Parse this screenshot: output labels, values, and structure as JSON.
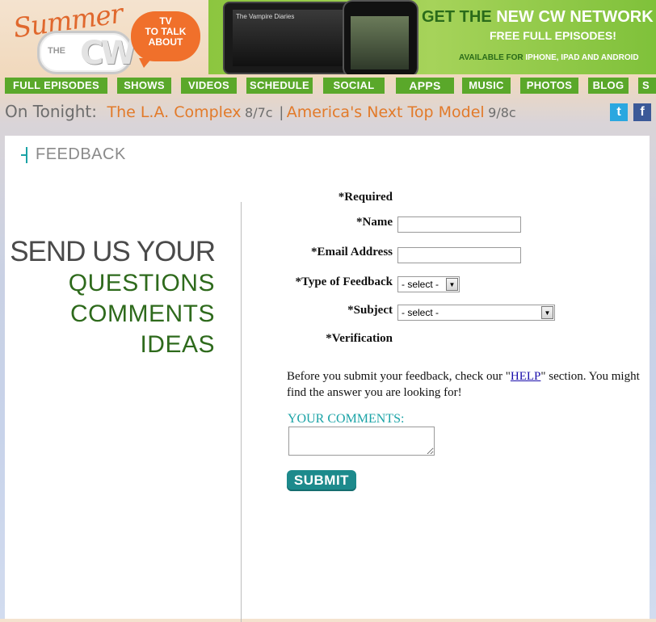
{
  "header": {
    "logo": {
      "summer": "Summer",
      "the": "THE",
      "cw": "CW",
      "tagline_line1": "TV",
      "tagline_line2": "TO TALK",
      "tagline_line3": "ABOUT"
    },
    "banner": {
      "title_dark": "GET THE ",
      "title_light": "NEW ",
      "title_dark2": "CW NETWORK A",
      "sub": "FREE FULL EPISODES!",
      "avail_prefix": "AVAILABLE FOR ",
      "avail_devices": "IPHONE, IPAD AND ANDROID",
      "tablet_label": "The Vampire Diaries"
    }
  },
  "nav": {
    "items": [
      {
        "label": "FULL EPISODES"
      },
      {
        "label": "SHOWS"
      },
      {
        "label": "VIDEOS"
      },
      {
        "label": "SCHEDULE"
      },
      {
        "label": "SOCIAL"
      },
      {
        "label": "APPS"
      },
      {
        "label": "MUSIC"
      },
      {
        "label": "PHOTOS"
      },
      {
        "label": "BLOG"
      },
      {
        "label": "S"
      }
    ]
  },
  "tonight": {
    "label": "On Tonight:",
    "shows": [
      {
        "name": "The L.A. Complex",
        "time": "8/7c"
      },
      {
        "name": "America's Next Top Model",
        "time": "9/8c"
      }
    ],
    "separator": "|"
  },
  "social": {
    "twitter": "t",
    "facebook": "f"
  },
  "page": {
    "title": "FEEDBACK"
  },
  "promo": {
    "line1": "SEND US YOUR",
    "line2": "QUESTIONS",
    "line3": "COMMENTS",
    "line4": "IDEAS"
  },
  "form": {
    "required_note": "*Required",
    "name_label": "*Name",
    "email_label": "*Email Address",
    "feedback_type_label": "*Type of Feedback",
    "feedback_type_value": "- select -",
    "subject_label": "*Subject",
    "subject_value": "- select -",
    "verification_label": "*Verification",
    "help_before": "Before you submit your feedback, check our \"",
    "help_link": "HELP",
    "help_after": "\" section. You might find the answer you are looking for!",
    "comments_label": "YOUR COMMENTS:",
    "submit_label": "SUBMIT"
  },
  "colors": {
    "nav_green": "#5aa82a",
    "accent_orange": "#e27a2a",
    "teal": "#1aa3a6",
    "dark_green": "#2e6a1c"
  }
}
